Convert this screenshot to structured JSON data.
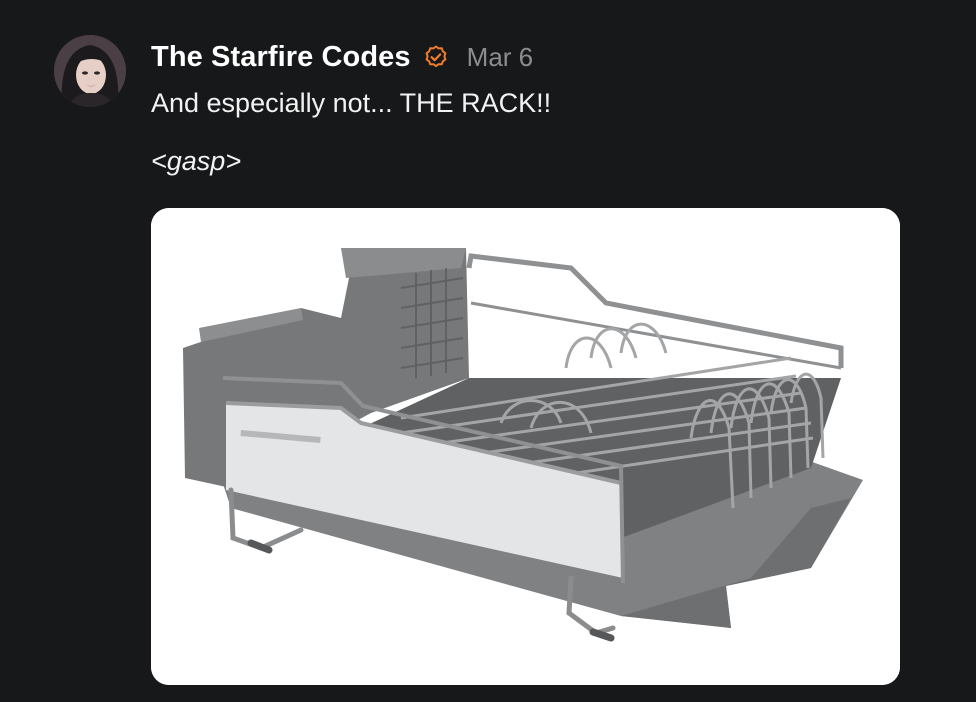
{
  "post": {
    "author": "The Starfire Codes",
    "verified_icon": "verified-check-icon",
    "date": "Mar 6",
    "text_line_1": "And especially not... THE RACK!!",
    "text_line_2": "<gasp>",
    "image_alt": "dish drying rack"
  },
  "colors": {
    "background": "#17181a",
    "author": "#ffffff",
    "date": "#8b8d91",
    "verified": "#f07c2c",
    "body_text": "#f2f2f2",
    "image_bg": "#ffffff"
  }
}
